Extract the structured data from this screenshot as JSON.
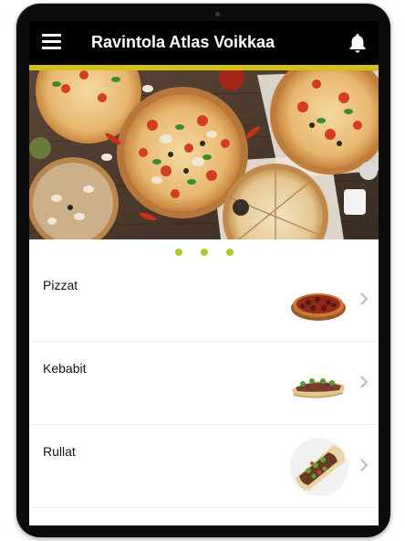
{
  "app": {
    "title": "Ravintola Atlas Voikkaa",
    "accent_color": "#d4c21c",
    "appbar_color": "#000000"
  },
  "icons": {
    "menu": "hamburger-menu-icon",
    "notifications": "bell-icon",
    "chevron": "chevron-right-icon"
  },
  "carousel": {
    "image": "pizza-spread-banner",
    "dot_count": 3,
    "dot_color": "#b5c92c"
  },
  "menu_items": [
    {
      "label": "Pizzat",
      "image": "pizza-thumbnail"
    },
    {
      "label": "Kebabit",
      "image": "kebab-thumbnail"
    },
    {
      "label": "Rullat",
      "image": "wrap-thumbnail"
    }
  ]
}
